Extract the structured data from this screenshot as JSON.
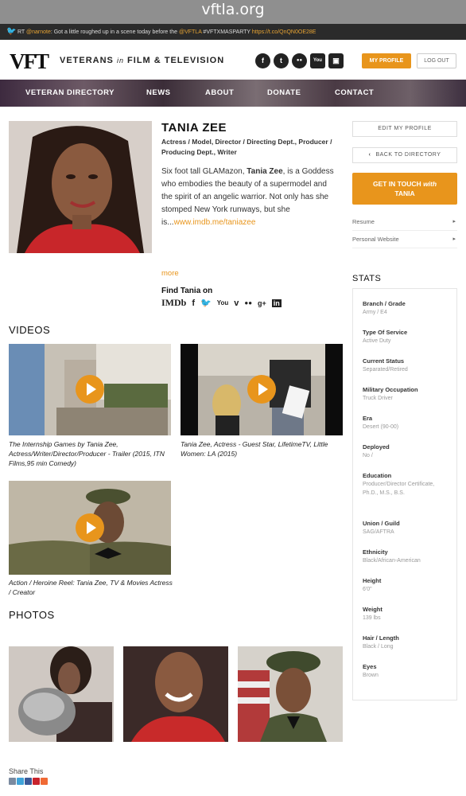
{
  "browser": {
    "url": "vftla.org"
  },
  "ticker": {
    "prefix": "RT",
    "handle": "@narnote",
    "text": ": Got a little roughed up in a scene today before the",
    "tag": "@VFTLA",
    "hashtag": " #VFTXMASPARTY ",
    "link": "https://t.co/QnQN0OE28E"
  },
  "header": {
    "logo_mark": "VFT",
    "logo_text_a": "VETERANS ",
    "logo_text_in": "in",
    "logo_text_b": " FILM & TELEVISION",
    "social": [
      "f",
      "t",
      "●●",
      "You",
      "▣"
    ],
    "my_profile": "MY PROFILE",
    "logout": "LOG OUT"
  },
  "nav": [
    "VETERAN DIRECTORY",
    "NEWS",
    "ABOUT",
    "DONATE",
    "CONTACT"
  ],
  "profile": {
    "name": "TANIA ZEE",
    "roles": "Actress / Model, Director / Directing Dept., Producer / Producing Dept., Writer",
    "bio_a": "Six foot tall GLAMazon, ",
    "bio_name": "Tania Zee",
    "bio_b": ", is a Goddess who embodies the beauty of a supermodel and the spirit of an angelic warrior. Not only has she stomped New York runways, but she is...",
    "bio_link": "www.imdb.me/taniazee",
    "more": "more",
    "find_on": "Find Tania on",
    "find_icons": [
      "IMDb",
      "f",
      "🐦",
      "You",
      "v",
      "●●",
      "g+",
      "in"
    ]
  },
  "sidebar": {
    "edit": "EDIT MY PROFILE",
    "back": "BACK TO DIRECTORY",
    "touch_a": "GET IN TOUCH ",
    "touch_with": "with",
    "touch_b": "TANIA",
    "links": [
      "Resume",
      "Personal Website"
    ],
    "stats_title": "STATS",
    "stats": [
      {
        "label": "Branch / Grade",
        "value": "Army / E4"
      },
      {
        "label": "Type Of Service",
        "value": "Active Duty"
      },
      {
        "label": "Current Status",
        "value": "Separated/Retired"
      },
      {
        "label": "Military Occupation",
        "value": "Truck Driver"
      },
      {
        "label": "Era",
        "value": "Desert (90-00)"
      },
      {
        "label": "Deployed",
        "value": "No /"
      },
      {
        "label": "Education",
        "value": "Producer/Director Certificate, Ph.D., M.S., B.S."
      },
      {
        "label": "Union / Guild",
        "value": "SAG/AFTRA"
      },
      {
        "label": "Ethnicity",
        "value": "Black/African-American"
      },
      {
        "label": "Height",
        "value": "6'0\""
      },
      {
        "label": "Weight",
        "value": "139 lbs"
      },
      {
        "label": "Hair / Length",
        "value": "Black / Long"
      },
      {
        "label": "Eyes",
        "value": "Brown"
      }
    ]
  },
  "videos": {
    "title": "VIDEOS",
    "items": [
      {
        "caption": "The Internship Games by Tania Zee, Actress/Writer/Director/Producer - Trailer (2015, ITN Films,95 min Comedy)"
      },
      {
        "caption": "Tania Zee, Actress - Guest Star, LifetimeTV, Little Women: LA (2015)"
      },
      {
        "caption": "Action / Heroine Reel: Tania Zee, TV & Movies Actress / Creator"
      }
    ]
  },
  "photos": {
    "title": "PHOTOS"
  },
  "share": {
    "label": "Share This"
  }
}
